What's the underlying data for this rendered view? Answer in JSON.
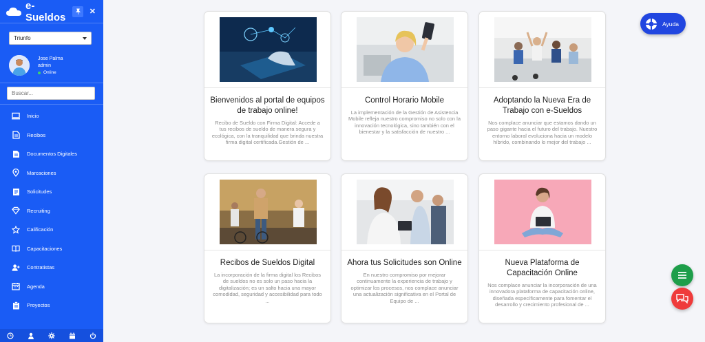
{
  "sidebar": {
    "logo": "e-Sueldos",
    "company_select": "Triunfo",
    "user": {
      "name": "Jose Palma",
      "role": "admin",
      "status": "Online"
    },
    "search_placeholder": "Buscar...",
    "items": [
      {
        "label": "Inicio",
        "icon": "monitor-icon"
      },
      {
        "label": "Recibos",
        "icon": "document-icon"
      },
      {
        "label": "Documentos Digitales",
        "icon": "documents-icon"
      },
      {
        "label": "Marcaciones",
        "icon": "map-pin-icon"
      },
      {
        "label": "Solicitudes",
        "icon": "list-document-icon"
      },
      {
        "label": "Recruiting",
        "icon": "diamond-icon"
      },
      {
        "label": "Calificación",
        "icon": "star-icon"
      },
      {
        "label": "Capacitaciones",
        "icon": "book-icon"
      },
      {
        "label": "Contratistas",
        "icon": "user-plus-icon"
      },
      {
        "label": "Agenda",
        "icon": "calendar-icon"
      },
      {
        "label": "Proyectos",
        "icon": "clipboard-icon"
      }
    ],
    "bottom_icons": [
      "clock-icon",
      "user-icon",
      "gear-icon",
      "calendar-icon",
      "power-icon"
    ]
  },
  "help_button": {
    "label": "Ayuda"
  },
  "cards": [
    {
      "title": "Bienvenidos al portal de equipos de trabajo online!",
      "excerpt": "Recibo de Sueldo con Firma Digital: Accede a tus recibos de sueldo de manera segura y ecológica, con la tranquilidad que brinda nuestra firma digital certificada.Gestión de ..."
    },
    {
      "title": "Control Horario Mobile",
      "excerpt": "La implementación de la Gestión de Asistencia Mobile refleja nuestro compromiso no solo con la innovación tecnológica, sino también con el bienestar y la satisfacción de nuestro ..."
    },
    {
      "title": "Adoptando la Nueva Era de Trabajo con e-Sueldos",
      "excerpt": "Nos complace anunciar que estamos dando un paso gigante hacia el futuro del trabajo. Nuestro entorno laboral evoluciona hacia un modelo híbrido, combinando lo mejor del trabajo ..."
    },
    {
      "title": "Recibos de Sueldos Digital",
      "excerpt": "La incorporación de la firma digital los Recibos de sueldos no es solo un paso hacia la digitalización; es un salto hacia una mayor comodidad, seguridad y accesibilidad para todo ..."
    },
    {
      "title": "Ahora tus Solicitudes son Online",
      "excerpt": "En nuestro compromiso por mejorar continuamente la experiencia de trabajo y optimizar los procesos, nos complace anunciar una actualización significativa en el Portal de Equipo de ..."
    },
    {
      "title": "Nueva Plataforma de Capacitación Online",
      "excerpt": "Nos complace anunciar la incorporación de una innovadora plataforma de capacitación online, diseñada específicamente para fomentar el desarrollo y crecimiento profesional de ..."
    }
  ],
  "colors": {
    "sidebar": "#1a5cf5",
    "help": "#2146e0",
    "fab_menu": "#1e9e4a",
    "fab_chat": "#ef3b3b"
  }
}
